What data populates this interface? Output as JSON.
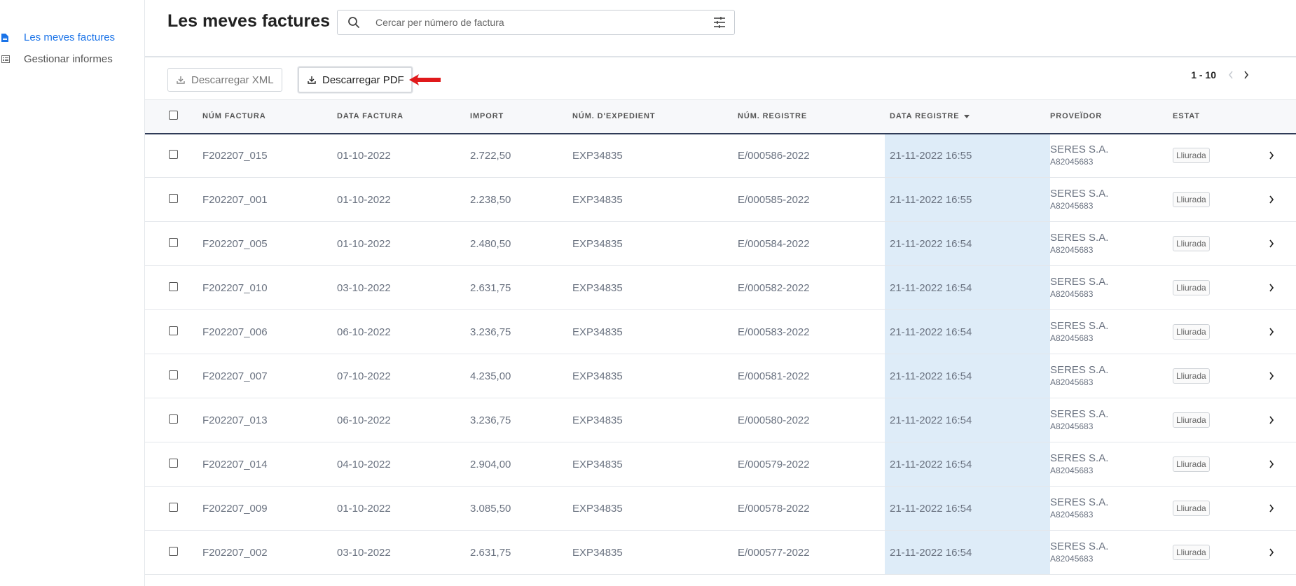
{
  "sidebar": {
    "items": [
      {
        "label": "Les meves factures",
        "icon": "document-icon",
        "active": true
      },
      {
        "label": "Gestionar informes",
        "icon": "list-icon",
        "active": false
      }
    ]
  },
  "header": {
    "title": "Les meves factures",
    "search_placeholder": "Cercar per número de factura"
  },
  "toolbar": {
    "xml_label": "Descarregar XML",
    "pdf_label": "Descarregar PDF",
    "pagination_range": "1 - 10"
  },
  "table": {
    "columns": [
      "NÚM FACTURA",
      "DATA FACTURA",
      "IMPORT",
      "NÚM. D'EXPEDIENT",
      "NÚM. REGISTRE",
      "DATA REGISTRE",
      "PROVEÏDOR",
      "ESTAT"
    ],
    "rows": [
      {
        "factura": "F202207_015",
        "data": "01-10-2022",
        "import": "2.722,50",
        "expedient": "EXP34835",
        "registre": "E/000586-2022",
        "data_registre": "21-11-2022 16:55",
        "proveidor": "SERES S.A.",
        "nif": "A82045683",
        "estat": "Lliurada"
      },
      {
        "factura": "F202207_001",
        "data": "01-10-2022",
        "import": "2.238,50",
        "expedient": "EXP34835",
        "registre": "E/000585-2022",
        "data_registre": "21-11-2022 16:55",
        "proveidor": "SERES S.A.",
        "nif": "A82045683",
        "estat": "Lliurada"
      },
      {
        "factura": "F202207_005",
        "data": "01-10-2022",
        "import": "2.480,50",
        "expedient": "EXP34835",
        "registre": "E/000584-2022",
        "data_registre": "21-11-2022 16:54",
        "proveidor": "SERES S.A.",
        "nif": "A82045683",
        "estat": "Lliurada"
      },
      {
        "factura": "F202207_010",
        "data": "03-10-2022",
        "import": "2.631,75",
        "expedient": "EXP34835",
        "registre": "E/000582-2022",
        "data_registre": "21-11-2022 16:54",
        "proveidor": "SERES S.A.",
        "nif": "A82045683",
        "estat": "Lliurada"
      },
      {
        "factura": "F202207_006",
        "data": "06-10-2022",
        "import": "3.236,75",
        "expedient": "EXP34835",
        "registre": "E/000583-2022",
        "data_registre": "21-11-2022 16:54",
        "proveidor": "SERES S.A.",
        "nif": "A82045683",
        "estat": "Lliurada"
      },
      {
        "factura": "F202207_007",
        "data": "07-10-2022",
        "import": "4.235,00",
        "expedient": "EXP34835",
        "registre": "E/000581-2022",
        "data_registre": "21-11-2022 16:54",
        "proveidor": "SERES S.A.",
        "nif": "A82045683",
        "estat": "Lliurada"
      },
      {
        "factura": "F202207_013",
        "data": "06-10-2022",
        "import": "3.236,75",
        "expedient": "EXP34835",
        "registre": "E/000580-2022",
        "data_registre": "21-11-2022 16:54",
        "proveidor": "SERES S.A.",
        "nif": "A82045683",
        "estat": "Lliurada"
      },
      {
        "factura": "F202207_014",
        "data": "04-10-2022",
        "import": "2.904,00",
        "expedient": "EXP34835",
        "registre": "E/000579-2022",
        "data_registre": "21-11-2022 16:54",
        "proveidor": "SERES S.A.",
        "nif": "A82045683",
        "estat": "Lliurada"
      },
      {
        "factura": "F202207_009",
        "data": "01-10-2022",
        "import": "3.085,50",
        "expedient": "EXP34835",
        "registre": "E/000578-2022",
        "data_registre": "21-11-2022 16:54",
        "proveidor": "SERES S.A.",
        "nif": "A82045683",
        "estat": "Lliurada"
      },
      {
        "factura": "F202207_002",
        "data": "03-10-2022",
        "import": "2.631,75",
        "expedient": "EXP34835",
        "registre": "E/000577-2022",
        "data_registre": "21-11-2022 16:54",
        "proveidor": "SERES S.A.",
        "nif": "A82045683",
        "estat": "Lliurada"
      }
    ]
  },
  "colors": {
    "accent": "#1a73e8",
    "highlight_column": "#deecf8",
    "header_border": "#2f3b57",
    "annotation_arrow": "#e0191b"
  }
}
